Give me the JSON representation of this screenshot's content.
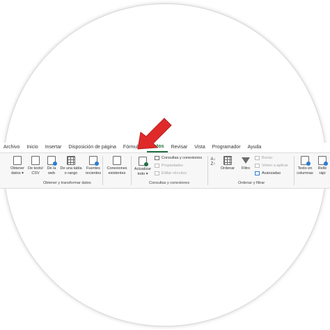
{
  "tabs": [
    "Archivo",
    "Inicio",
    "Insertar",
    "Disposición de página",
    "Fórmulas",
    "Datos",
    "Revisar",
    "Vista",
    "Programador",
    "Ayuda"
  ],
  "active_tab_index": 5,
  "groups": {
    "obtener": {
      "label": "Obtener y transformar datos",
      "buttons": [
        {
          "label": "Obtener\ndatos ▾",
          "icon": "database-icon"
        },
        {
          "label": "De texto/\nCSV",
          "icon": "text-file-icon"
        },
        {
          "label": "De la\nweb",
          "icon": "web-icon"
        },
        {
          "label": "De una tabla\no rango",
          "icon": "table-icon"
        },
        {
          "label": "Fuentes\nrecientes",
          "icon": "recent-sources-icon"
        },
        {
          "label": "Conexiones\nexistentes",
          "icon": "existing-connections-icon"
        }
      ]
    },
    "consultas": {
      "label": "Consultas y conexiones",
      "refresh_label": "Actualizar\ntodo ▾",
      "items": [
        "Consultas y conexiones",
        "Propiedades",
        "Editar vínculos"
      ]
    },
    "ordenar": {
      "label": "Ordenar y filtrar",
      "sort_label": "Ordenar",
      "filter_label": "Filtro",
      "items": [
        "Borrar",
        "Volver a aplicar",
        "Avanzadas"
      ]
    },
    "herramientas": {
      "text_to_columns": "Texto en\ncolumnas",
      "flash_fill": "Relle\nrápi"
    }
  },
  "colors": {
    "accent": "#1e6e3c",
    "arrow": "#e02a2a"
  }
}
